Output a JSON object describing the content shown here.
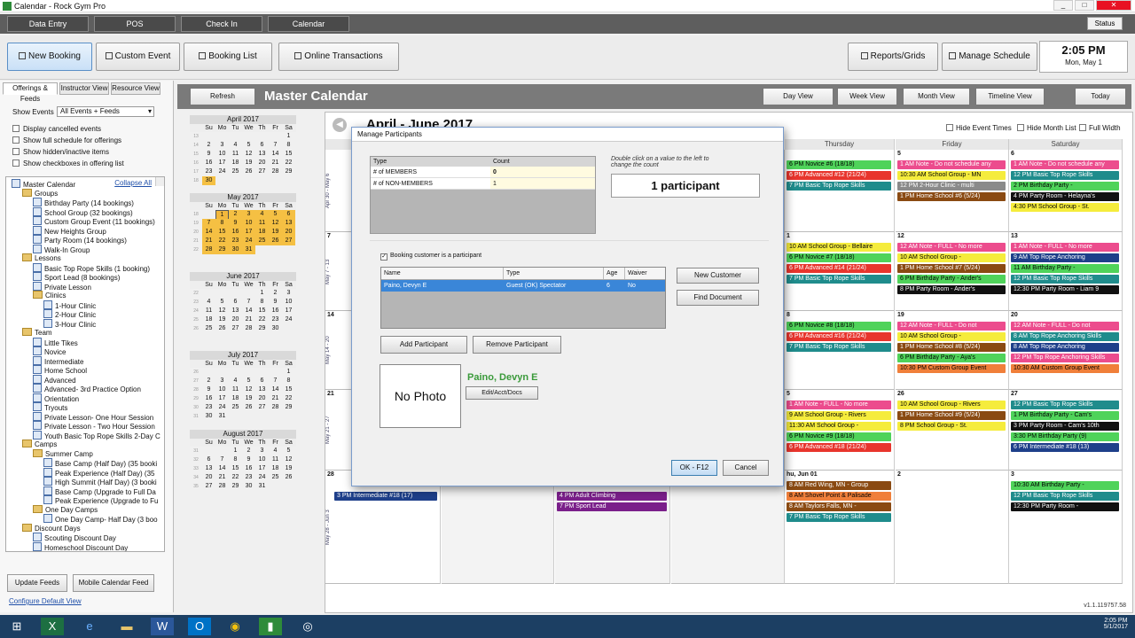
{
  "window": {
    "title": "Calendar - Rock Gym Pro",
    "min": "_",
    "max": "□",
    "close": "✕"
  },
  "nav": {
    "items": [
      "Data Entry",
      "POS",
      "Check In",
      "Calendar"
    ],
    "status": "Status"
  },
  "toolbar": {
    "new_booking": "New Booking",
    "custom_event": "Custom Event",
    "booking_list": "Booking List",
    "online_transactions": "Online Transactions",
    "reports": "Reports/Grids",
    "manage_schedule": "Manage Schedule",
    "time": "2:05 PM",
    "date": "Mon, May 1"
  },
  "left": {
    "tabs": [
      "Offerings & Feeds",
      "Instructor View",
      "Resource View"
    ],
    "show_events_label": "Show Events",
    "show_events_value": "All Events + Feeds",
    "checks": [
      "Display cancelled events",
      "Show full schedule for offerings",
      "Show hidden/inactive items",
      "Show checkboxes in offering list"
    ],
    "collapse_all": "Collapse All",
    "tree": [
      {
        "t": "Master Calendar",
        "l": 0,
        "k": "cal"
      },
      {
        "t": "Groups",
        "l": 1,
        "k": "fold"
      },
      {
        "t": "Birthday Party (14 bookings)",
        "l": 2,
        "k": "cal"
      },
      {
        "t": "School Group (32 bookings)",
        "l": 2,
        "k": "cal"
      },
      {
        "t": "Custom Group Event (11 bookings)",
        "l": 2,
        "k": "cal"
      },
      {
        "t": "New Heights Group",
        "l": 2,
        "k": "cal"
      },
      {
        "t": "Party Room (14 bookings)",
        "l": 2,
        "k": "cal"
      },
      {
        "t": "Walk-In Group",
        "l": 2,
        "k": "cal"
      },
      {
        "t": "Lessons",
        "l": 1,
        "k": "fold"
      },
      {
        "t": "Basic Top Rope Skills (1 booking)",
        "l": 2,
        "k": "cal"
      },
      {
        "t": "Sport Lead (8 bookings)",
        "l": 2,
        "k": "cal"
      },
      {
        "t": "Private Lesson",
        "l": 2,
        "k": "cal"
      },
      {
        "t": "Clinics",
        "l": 2,
        "k": "fold"
      },
      {
        "t": "1-Hour Clinic",
        "l": 3,
        "k": "cal"
      },
      {
        "t": "2-Hour Clinic",
        "l": 3,
        "k": "cal"
      },
      {
        "t": "3-Hour Clinic",
        "l": 3,
        "k": "cal"
      },
      {
        "t": "Team",
        "l": 1,
        "k": "fold"
      },
      {
        "t": "Little Tikes",
        "l": 2,
        "k": "cal"
      },
      {
        "t": "Novice",
        "l": 2,
        "k": "cal"
      },
      {
        "t": "Intermediate",
        "l": 2,
        "k": "cal"
      },
      {
        "t": "Home School",
        "l": 2,
        "k": "cal"
      },
      {
        "t": "Advanced",
        "l": 2,
        "k": "cal"
      },
      {
        "t": "Advanced- 3rd Practice Option",
        "l": 2,
        "k": "cal"
      },
      {
        "t": "Orientation",
        "l": 2,
        "k": "cal"
      },
      {
        "t": "Tryouts",
        "l": 2,
        "k": "cal"
      },
      {
        "t": "Private Lesson- One Hour Session",
        "l": 2,
        "k": "cal"
      },
      {
        "t": "Private Lesson - Two Hour Session",
        "l": 2,
        "k": "cal"
      },
      {
        "t": "Youth Basic Top Rope Skills 2-Day C",
        "l": 2,
        "k": "cal"
      },
      {
        "t": "Camps",
        "l": 1,
        "k": "fold"
      },
      {
        "t": "Summer Camp",
        "l": 2,
        "k": "fold"
      },
      {
        "t": "Base Camp (Half Day) (35 booki",
        "l": 3,
        "k": "cal"
      },
      {
        "t": "Peak Experience (Half Day) (35",
        "l": 3,
        "k": "cal"
      },
      {
        "t": "High Summit (Half Day) (3 booki",
        "l": 3,
        "k": "cal"
      },
      {
        "t": "Base Camp (Upgrade to Full Da",
        "l": 3,
        "k": "cal"
      },
      {
        "t": "Peak Experience (Upgrade to Fu",
        "l": 3,
        "k": "cal"
      },
      {
        "t": "One Day Camps",
        "l": 2,
        "k": "fold"
      },
      {
        "t": "One Day Camp- Half Day (3 boo",
        "l": 3,
        "k": "cal"
      },
      {
        "t": "Discount Days",
        "l": 1,
        "k": "fold"
      },
      {
        "t": "Scouting Discount Day",
        "l": 2,
        "k": "cal"
      },
      {
        "t": "Homeschool Discount Day",
        "l": 2,
        "k": "cal"
      }
    ],
    "update_feeds": "Update Feeds",
    "mobile_feed": "Mobile Calendar Feed",
    "configure": "Configure Default View"
  },
  "calendar": {
    "refresh": "Refresh",
    "title": "Master Calendar",
    "views": [
      "Day View",
      "Week View",
      "Month View",
      "Timeline View",
      "Today"
    ],
    "range": "April - June 2017",
    "hide_event_times": "Hide Event Times",
    "hide_month_list": "Hide Month List",
    "full_width": "Full Width",
    "days": [
      "Sun, Ap",
      "Thursday",
      "Friday",
      "Saturday"
    ],
    "weeks": [
      "Apr 30 - May 6",
      "May 7 - 13",
      "May 14 - 20",
      "May 21 - 27",
      "May 28 - Jun 3"
    ],
    "daynums": [
      [
        "",
        "",
        "5",
        "6"
      ],
      [
        "7",
        "1",
        "12",
        "13"
      ],
      [
        "14",
        "8",
        "19",
        "20"
      ],
      [
        "21",
        "5",
        "26",
        "27"
      ],
      [
        "28",
        "hu, Jun 01",
        "2",
        "3"
      ]
    ],
    "events": [
      {
        "c": 1,
        "r": 0,
        "t": "6 PM Novice #6 (18/18)",
        "bg": "#4fd35a",
        "fg": "#000"
      },
      {
        "c": 1,
        "r": 0,
        "t": "6 PM Advanced #12 (21/24)",
        "bg": "#e8352d",
        "fg": "#fff"
      },
      {
        "c": 1,
        "r": 0,
        "t": "7 PM Basic Top Rope Skills",
        "bg": "#1f8c8c",
        "fg": "#fff"
      },
      {
        "c": 2,
        "r": 0,
        "t": "1 AM Note - Do not schedule any",
        "bg": "#ec4c8d",
        "fg": "#fff"
      },
      {
        "c": 2,
        "r": 0,
        "t": "10:30 AM School Group - MN",
        "bg": "#f5ec3c",
        "fg": "#000"
      },
      {
        "c": 2,
        "r": 0,
        "t": "12 PM 2-Hour Clinic - multi",
        "bg": "#8a8a8a",
        "fg": "#fff"
      },
      {
        "c": 2,
        "r": 0,
        "t": "1 PM Home School #6 (5/24)",
        "bg": "#8a4a12",
        "fg": "#fff"
      },
      {
        "c": 3,
        "r": 0,
        "t": "1 AM Note - Do not schedule any",
        "bg": "#ec4c8d",
        "fg": "#fff"
      },
      {
        "c": 3,
        "r": 0,
        "t": "12 PM Basic Top Rope Skills",
        "bg": "#1f8c8c",
        "fg": "#fff"
      },
      {
        "c": 3,
        "r": 0,
        "t": "2 PM Birthday Party -",
        "bg": "#4fd35a",
        "fg": "#000"
      },
      {
        "c": 3,
        "r": 0,
        "t": "4 PM Party Room - Helayna's",
        "bg": "#111",
        "fg": "#fff"
      },
      {
        "c": 3,
        "r": 0,
        "t": "4:30 PM School Group - St.",
        "bg": "#f5ec3c",
        "fg": "#000"
      },
      {
        "c": 1,
        "r": 1,
        "t": "10 AM School Group - Bellaire",
        "bg": "#f5ec3c",
        "fg": "#000"
      },
      {
        "c": 1,
        "r": 1,
        "t": "6 PM Novice #7 (18/18)",
        "bg": "#4fd35a",
        "fg": "#000"
      },
      {
        "c": 1,
        "r": 1,
        "t": "6 PM Advanced #14 (21/24)",
        "bg": "#e8352d",
        "fg": "#fff"
      },
      {
        "c": 1,
        "r": 1,
        "t": "7 PM Basic Top Rope Skills",
        "bg": "#1f8c8c",
        "fg": "#fff"
      },
      {
        "c": 2,
        "r": 1,
        "t": "12 AM Note - FULL - No more",
        "bg": "#ec4c8d",
        "fg": "#fff"
      },
      {
        "c": 2,
        "r": 1,
        "t": "10 AM School Group -",
        "bg": "#f5ec3c",
        "fg": "#000"
      },
      {
        "c": 2,
        "r": 1,
        "t": "1 PM Home School #7 (5/24)",
        "bg": "#8a4a12",
        "fg": "#fff"
      },
      {
        "c": 2,
        "r": 1,
        "t": "6 PM Birthday Party - Ander's",
        "bg": "#4fd35a",
        "fg": "#000"
      },
      {
        "c": 2,
        "r": 1,
        "t": "8 PM Party Room - Ander's",
        "bg": "#111",
        "fg": "#fff"
      },
      {
        "c": 3,
        "r": 1,
        "t": "1 AM Note - FULL - No more",
        "bg": "#ec4c8d",
        "fg": "#fff"
      },
      {
        "c": 3,
        "r": 1,
        "t": "9 AM Top Rope Anchoring",
        "bg": "#1e3f8a",
        "fg": "#fff"
      },
      {
        "c": 3,
        "r": 1,
        "t": "11 AM Birthday Party -",
        "bg": "#4fd35a",
        "fg": "#000"
      },
      {
        "c": 3,
        "r": 1,
        "t": "12 PM Basic Top Rope Skills",
        "bg": "#1f8c8c",
        "fg": "#fff"
      },
      {
        "c": 3,
        "r": 1,
        "t": "12:30 PM Party Room - Liam 9",
        "bg": "#111",
        "fg": "#fff"
      },
      {
        "c": 1,
        "r": 2,
        "t": "6 PM Novice #8 (18/18)",
        "bg": "#4fd35a",
        "fg": "#000"
      },
      {
        "c": 1,
        "r": 2,
        "t": "6 PM Advanced #16 (21/24)",
        "bg": "#e8352d",
        "fg": "#fff"
      },
      {
        "c": 1,
        "r": 2,
        "t": "7 PM Basic Top Rope Skills",
        "bg": "#1f8c8c",
        "fg": "#fff"
      },
      {
        "c": 2,
        "r": 2,
        "t": "12 AM Note - FULL - Do not",
        "bg": "#ec4c8d",
        "fg": "#fff"
      },
      {
        "c": 2,
        "r": 2,
        "t": "10 AM School Group -",
        "bg": "#f5ec3c",
        "fg": "#000"
      },
      {
        "c": 2,
        "r": 2,
        "t": "1 PM Home School #8 (5/24)",
        "bg": "#8a4a12",
        "fg": "#fff"
      },
      {
        "c": 2,
        "r": 2,
        "t": "6 PM Birthday Party - Aya's",
        "bg": "#4fd35a",
        "fg": "#000"
      },
      {
        "c": 2,
        "r": 2,
        "t": "10:30 PM Custom Group Event",
        "bg": "#f07f3a",
        "fg": "#000"
      },
      {
        "c": 3,
        "r": 2,
        "t": "12 AM Note - FULL - Do not",
        "bg": "#ec4c8d",
        "fg": "#fff"
      },
      {
        "c": 3,
        "r": 2,
        "t": "8 AM Top Rope Anchoring Skills",
        "bg": "#1f8c8c",
        "fg": "#fff"
      },
      {
        "c": 3,
        "r": 2,
        "t": "8 AM Top Rope Anchoring",
        "bg": "#1e3f8a",
        "fg": "#fff"
      },
      {
        "c": 3,
        "r": 2,
        "t": "12 PM Top Rope Anchoring Skills",
        "bg": "#ec4c8d",
        "fg": "#fff"
      },
      {
        "c": 3,
        "r": 2,
        "t": "10:30 AM Custom Group Event",
        "bg": "#f07f3a",
        "fg": "#000"
      },
      {
        "c": 1,
        "r": 3,
        "t": "1 AM Note - FULL - No more",
        "bg": "#ec4c8d",
        "fg": "#fff"
      },
      {
        "c": 1,
        "r": 3,
        "t": "9 AM School Group - Rivers",
        "bg": "#f5ec3c",
        "fg": "#000"
      },
      {
        "c": 1,
        "r": 3,
        "t": "11:30 AM School Group -",
        "bg": "#f5ec3c",
        "fg": "#000"
      },
      {
        "c": 1,
        "r": 3,
        "t": "6 PM Novice #9 (18/18)",
        "bg": "#4fd35a",
        "fg": "#000"
      },
      {
        "c": 1,
        "r": 3,
        "t": "6 PM Advanced #18 (21/24)",
        "bg": "#e8352d",
        "fg": "#fff"
      },
      {
        "c": 2,
        "r": 3,
        "t": "10 AM School Group - Rivers",
        "bg": "#f5ec3c",
        "fg": "#000"
      },
      {
        "c": 2,
        "r": 3,
        "t": "1 PM Home School #9 (5/24)",
        "bg": "#8a4a12",
        "fg": "#fff"
      },
      {
        "c": 2,
        "r": 3,
        "t": "8 PM School Group - St.",
        "bg": "#f5ec3c",
        "fg": "#000"
      },
      {
        "c": 3,
        "r": 3,
        "t": "12 PM Basic Top Rope Skills",
        "bg": "#1f8c8c",
        "fg": "#fff"
      },
      {
        "c": 3,
        "r": 3,
        "t": "1 PM Birthday Party - Cam's",
        "bg": "#4fd35a",
        "fg": "#000"
      },
      {
        "c": 3,
        "r": 3,
        "t": "3 PM Party Room - Cam's 10th",
        "bg": "#111",
        "fg": "#fff"
      },
      {
        "c": 3,
        "r": 3,
        "t": "3:30 PM Birthday Party (9)",
        "bg": "#4fd35a",
        "fg": "#000"
      },
      {
        "c": 3,
        "r": 3,
        "t": "6 PM Intermediate #18 (13)",
        "bg": "#1e3f8a",
        "fg": "#fff"
      },
      {
        "c": 1,
        "r": 4,
        "t": "8 AM Red Wing, MN - Group",
        "bg": "#8a4a12",
        "fg": "#fff"
      },
      {
        "c": 1,
        "r": 4,
        "t": "8 AM Shovel Point & Palisade",
        "bg": "#f07f3a",
        "fg": "#000"
      },
      {
        "c": 1,
        "r": 4,
        "t": "8 AM Taylors Falls, MN -",
        "bg": "#8a4a12",
        "fg": "#fff"
      },
      {
        "c": 1,
        "r": 4,
        "t": "7 PM Basic Top Rope Skills",
        "bg": "#1f8c8c",
        "fg": "#fff"
      },
      {
        "c": 3,
        "r": 4,
        "t": "10:30 AM Birthday Party -",
        "bg": "#4fd35a",
        "fg": "#000"
      },
      {
        "c": 3,
        "r": 4,
        "t": "12 PM Basic Top Rope Skills",
        "bg": "#1f8c8c",
        "fg": "#fff"
      },
      {
        "c": 3,
        "r": 4,
        "t": "12:30 PM Party Room -",
        "bg": "#111",
        "fg": "#fff"
      }
    ],
    "mid_events": [
      {
        "t": "3 PM Intermediate #18 (17)",
        "bg": "#1e3f8a",
        "fg": "#fff",
        "col": 0
      },
      {
        "t": "4 PM Adult Climbing",
        "bg": "#7a1f8a",
        "fg": "#fff",
        "col": 1
      },
      {
        "t": "7 PM Sport Lead",
        "bg": "#7a1f8a",
        "fg": "#fff",
        "col": 1
      }
    ]
  },
  "mini_cal": [
    {
      "title": "April 2017",
      "rows": [
        [
          "13",
          "",
          "",
          "",
          "",
          "",
          "",
          "1"
        ],
        [
          "14",
          "2",
          "3",
          "4",
          "5",
          "6",
          "7",
          "8"
        ],
        [
          "15",
          "9",
          "10",
          "11",
          "12",
          "13",
          "14",
          "15"
        ],
        [
          "16",
          "16",
          "17",
          "18",
          "19",
          "20",
          "21",
          "22"
        ],
        [
          "17",
          "23",
          "24",
          "25",
          "26",
          "27",
          "28",
          "29"
        ],
        [
          "18",
          "30",
          "",
          "",
          "",
          "",
          "",
          ""
        ]
      ]
    },
    {
      "title": "May 2017",
      "rows": [
        [
          "18",
          "",
          "1",
          "2",
          "3",
          "4",
          "5",
          "6"
        ],
        [
          "19",
          "7",
          "8",
          "9",
          "10",
          "11",
          "12",
          "13"
        ],
        [
          "20",
          "14",
          "15",
          "16",
          "17",
          "18",
          "19",
          "20"
        ],
        [
          "21",
          "21",
          "22",
          "23",
          "24",
          "25",
          "26",
          "27"
        ],
        [
          "22",
          "28",
          "29",
          "30",
          "31",
          "",
          "",
          ""
        ]
      ]
    },
    {
      "title": "June 2017",
      "rows": [
        [
          "22",
          "",
          "",
          "",
          "",
          "1",
          "2",
          "3"
        ],
        [
          "23",
          "4",
          "5",
          "6",
          "7",
          "8",
          "9",
          "10"
        ],
        [
          "24",
          "11",
          "12",
          "13",
          "14",
          "15",
          "16",
          "17"
        ],
        [
          "25",
          "18",
          "19",
          "20",
          "21",
          "22",
          "23",
          "24"
        ],
        [
          "26",
          "25",
          "26",
          "27",
          "28",
          "29",
          "30",
          ""
        ]
      ]
    },
    {
      "title": "July 2017",
      "rows": [
        [
          "26",
          "",
          "",
          "",
          "",
          "",
          "",
          "1"
        ],
        [
          "27",
          "2",
          "3",
          "4",
          "5",
          "6",
          "7",
          "8"
        ],
        [
          "28",
          "9",
          "10",
          "11",
          "12",
          "13",
          "14",
          "15"
        ],
        [
          "29",
          "16",
          "17",
          "18",
          "19",
          "20",
          "21",
          "22"
        ],
        [
          "30",
          "23",
          "24",
          "25",
          "26",
          "27",
          "28",
          "29"
        ],
        [
          "31",
          "30",
          "31",
          "",
          "",
          "",
          "",
          ""
        ]
      ]
    },
    {
      "title": "August 2017",
      "rows": [
        [
          "31",
          "",
          "",
          "1",
          "2",
          "3",
          "4",
          "5"
        ],
        [
          "32",
          "6",
          "7",
          "8",
          "9",
          "10",
          "11",
          "12"
        ],
        [
          "33",
          "13",
          "14",
          "15",
          "16",
          "17",
          "18",
          "19"
        ],
        [
          "34",
          "20",
          "21",
          "22",
          "23",
          "24",
          "25",
          "26"
        ],
        [
          "35",
          "27",
          "28",
          "29",
          "30",
          "31",
          "",
          ""
        ]
      ]
    }
  ],
  "mini_days": [
    "Su",
    "Mo",
    "Tu",
    "We",
    "Th",
    "Fr",
    "Sa"
  ],
  "dialog": {
    "title": "Manage Participants",
    "col_type": "Type",
    "col_count": "Count",
    "rows": [
      {
        "type": "# of MEMBERS",
        "count": "0"
      },
      {
        "type": "# of NON-MEMBERS",
        "count": "1"
      }
    ],
    "hint": "Double click on a value to the left to change the count",
    "participants": "1 participant",
    "booking_chk": "Booking customer is a participant",
    "pcols": [
      "Name",
      "Type",
      "Age",
      "Waiver"
    ],
    "prow": [
      "Paino, Devyn E",
      "Guest (OK) Spectator",
      "6",
      "No"
    ],
    "new_customer": "New Customer",
    "find_document": "Find Document",
    "add_participant": "Add Participant",
    "remove_participant": "Remove Participant",
    "no_photo": "No Photo",
    "name": "Paino, Devyn E",
    "edit": "Edit/Acct/Docs",
    "ok": "OK - F12",
    "cancel": "Cancel"
  },
  "version": "v1.1.119757.58",
  "tray": {
    "time": "2:05 PM",
    "date": "5/1/2017"
  }
}
